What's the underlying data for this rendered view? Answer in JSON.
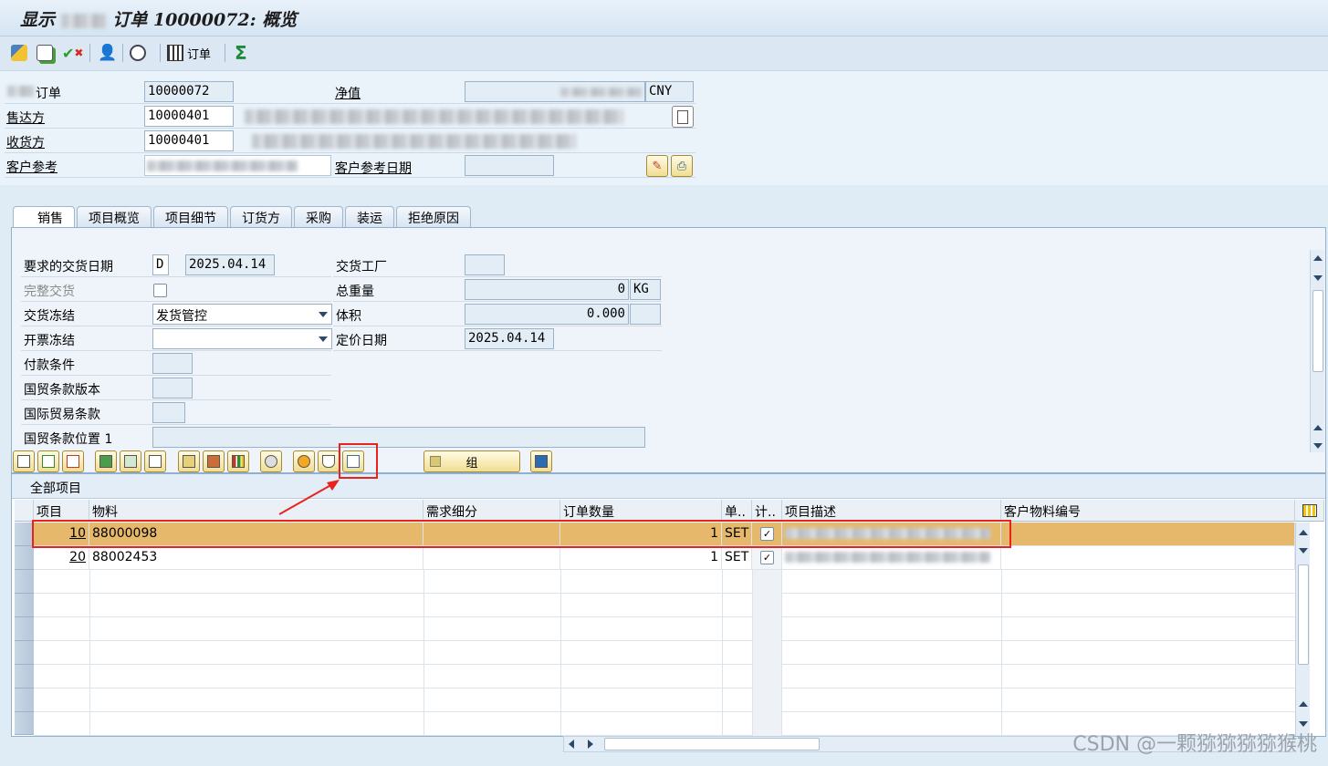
{
  "window": {
    "title_prefix": "显示",
    "title_suffix": "订单 10000072: 概览"
  },
  "toolbar": {
    "order_label": "订单",
    "icons": [
      "display-change-icon",
      "document-flow-icon",
      "check-icon",
      "partner-icon",
      "status-overview-icon",
      "order-table-icon",
      "sum-icon"
    ]
  },
  "header": {
    "order_label": "订单",
    "order_value": "10000072",
    "netvalue_label": "净值",
    "currency": "CNY",
    "soldto_label": "售达方",
    "soldto_value": "10000401",
    "shipto_label": "收货方",
    "shipto_value": "10000401",
    "custref_label": "客户参考",
    "custrefdate_label": "客户参考日期"
  },
  "tabs": [
    "销售",
    "项目概览",
    "项目细节",
    "订货方",
    "采购",
    "装运",
    "拒绝原因"
  ],
  "sales": {
    "req_delivery_date_label": "要求的交货日期",
    "req_delivery_date_type": "D",
    "req_delivery_date": "2025.04.14",
    "complete_delivery_label": "完整交货",
    "delivery_block_label": "交货冻结",
    "delivery_block_value": "发货管控",
    "billing_block_label": "开票冻结",
    "payment_terms_label": "付款条件",
    "incoterms_version_label": "国贸条款版本",
    "incoterms_label": "国际贸易条款",
    "incoterms_location_label": "国贸条款位置 1",
    "plant_label": "交货工厂",
    "total_weight_label": "总重量",
    "total_weight_value": "0",
    "weight_unit": "KG",
    "volume_label": "体积",
    "volume_value": "0.000",
    "pricing_date_label": "定价日期",
    "pricing_date": "2025.04.14"
  },
  "grid": {
    "title": "全部项目",
    "group_button_label": "组",
    "columns": [
      "项目",
      "物料",
      "需求细分",
      "订单数量",
      "单..",
      "计..",
      "项目描述",
      "客户物料编号"
    ],
    "rows": [
      {
        "item": "10",
        "material": "88000098",
        "qty": "1",
        "unit": "SET",
        "checked": true
      },
      {
        "item": "20",
        "material": "88002453",
        "qty": "1",
        "unit": "SET",
        "checked": true
      }
    ]
  },
  "watermark": "CSDN @一颗猕猕猕猕猴桃"
}
